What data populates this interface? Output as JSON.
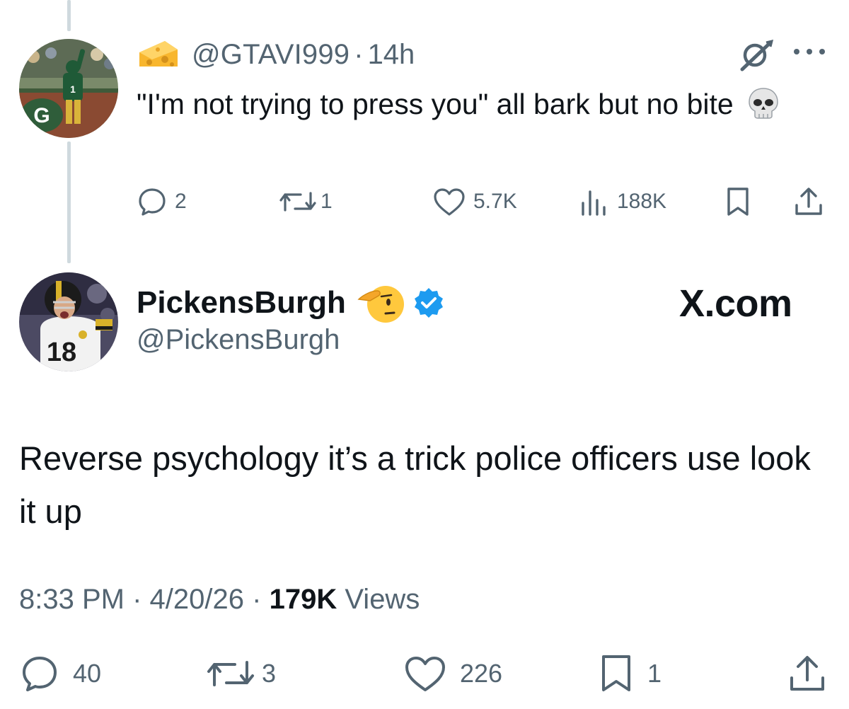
{
  "reply": {
    "avatar_icon": "packers-player-avatar",
    "badge_icon": "cheese-icon",
    "handle": "@GTAVI999",
    "separator": "·",
    "time": "14h",
    "text": "\"I'm not trying to press you\" all bark but no bite",
    "emoji_icon": "skull-icon",
    "actions": {
      "replies": "2",
      "reposts": "1",
      "likes": "5.7K",
      "views": "188K"
    }
  },
  "post": {
    "avatar_icon": "steelers-player-avatar",
    "display_name": "PickensBurgh",
    "name_emoji_icon": "saluting-face-icon",
    "verified_icon": "verified-badge-icon",
    "handle": "@PickensBurgh",
    "watermark": "X.com",
    "text": "Reverse psychology it’s a trick police officers use look it up",
    "time": "8:33 PM",
    "separator": "·",
    "date": "4/20/26",
    "views_count": "179K",
    "views_label": "Views",
    "actions": {
      "replies": "40",
      "reposts": "3",
      "likes": "226",
      "bookmarks": "1"
    }
  },
  "colors": {
    "text_primary": "#0f1419",
    "text_secondary": "#536471",
    "thread_line": "#cfd9de",
    "verified_blue": "#1d9bf0"
  }
}
